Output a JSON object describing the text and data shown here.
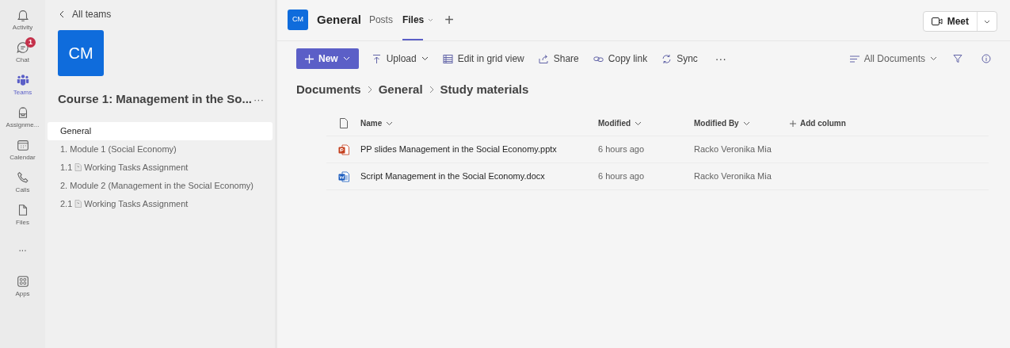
{
  "rail": [
    {
      "label": "Activity",
      "kind": "bell",
      "selected": false
    },
    {
      "label": "Chat",
      "kind": "chat",
      "selected": false,
      "badge": "1"
    },
    {
      "label": "Teams",
      "kind": "teams",
      "selected": true
    },
    {
      "label": "Assignme...",
      "kind": "backpack",
      "selected": false
    },
    {
      "label": "Calendar",
      "kind": "calendar",
      "selected": false
    },
    {
      "label": "Calls",
      "kind": "phone",
      "selected": false
    },
    {
      "label": "Files",
      "kind": "file",
      "selected": false
    },
    {
      "label": "...",
      "kind": "more",
      "selected": false
    },
    {
      "label": "Apps",
      "kind": "apps",
      "selected": false
    }
  ],
  "sidebar": {
    "back": "All teams",
    "avatar": "CM",
    "team_name": "Course 1: Management in the So...",
    "more": "···",
    "channels": [
      {
        "kind": "channel",
        "label": "General",
        "selected": true
      },
      {
        "kind": "channel",
        "label": "1. Module 1 (Social Economy)",
        "selected": false
      },
      {
        "kind": "page",
        "prefix": "1.1",
        "label": "Working Tasks Assignment",
        "selected": false
      },
      {
        "kind": "channel",
        "label": "2. Module 2 (Management in the Social Economy)",
        "selected": false
      },
      {
        "kind": "page",
        "prefix": "2.1",
        "label": "Working Tasks Assignment",
        "selected": false
      }
    ]
  },
  "header": {
    "avatar": "CM",
    "channel": "General",
    "tabs": [
      {
        "label": "Posts",
        "selected": false
      },
      {
        "label": "Files",
        "selected": true,
        "caret": true
      }
    ],
    "add": "+",
    "meet": "Meet"
  },
  "toolbar": {
    "new": "New",
    "actions": [
      {
        "kind": "upload",
        "label": "Upload",
        "caret": true
      },
      {
        "kind": "grid",
        "label": "Edit in grid view"
      },
      {
        "kind": "share",
        "label": "Share"
      },
      {
        "kind": "link",
        "label": "Copy link"
      },
      {
        "kind": "sync",
        "label": "Sync"
      }
    ],
    "more": "···",
    "view": "All Documents"
  },
  "breadcrumb": [
    "Documents",
    "General",
    "Study materials"
  ],
  "table": {
    "columns": [
      "Name",
      "Modified",
      "Modified By"
    ],
    "add_column": "Add column",
    "rows": [
      {
        "kind": "pptx",
        "name": "PP slides Management in the Social Economy.pptx",
        "modified": "6 hours ago",
        "modified_by": "Racko Veronika Mia"
      },
      {
        "kind": "docx",
        "name": "Script Management in the Social Economy.docx",
        "modified": "6 hours ago",
        "modified_by": "Racko Veronika Mia"
      }
    ]
  }
}
